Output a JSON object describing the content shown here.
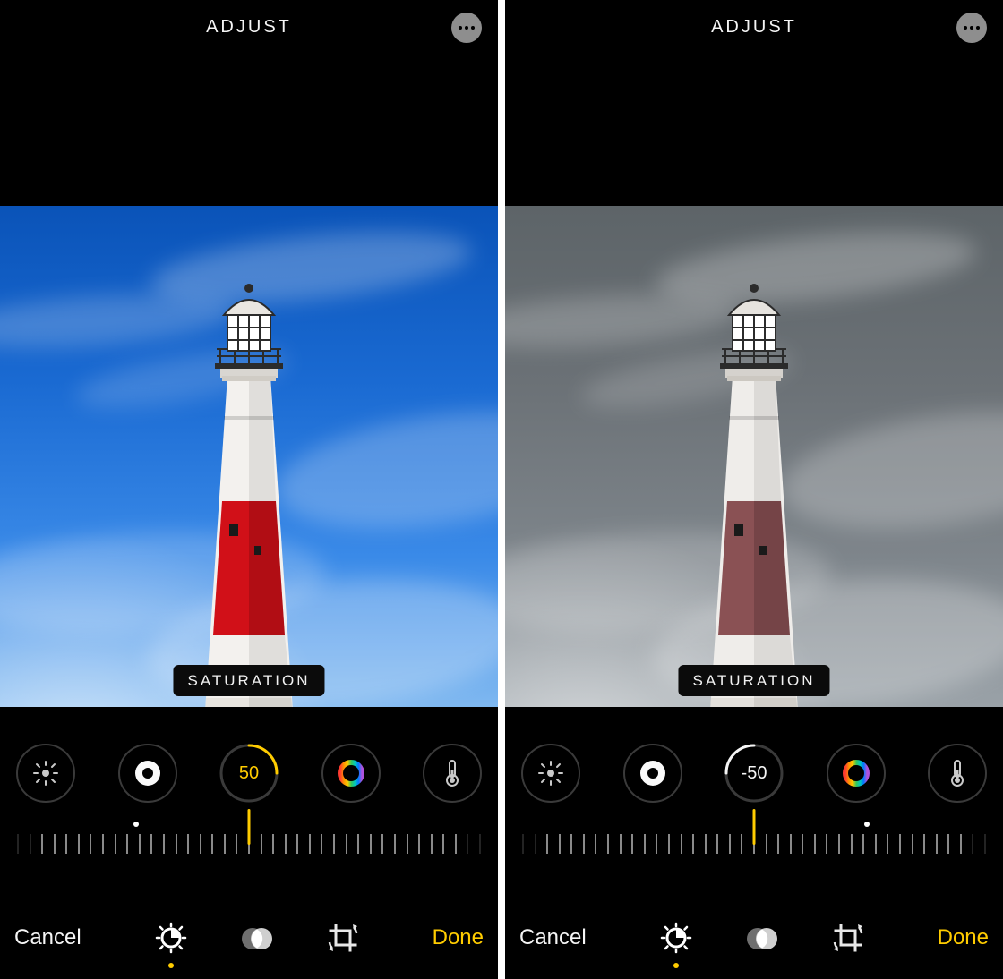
{
  "panels": [
    {
      "title": "ADJUST",
      "adjustment_label": "SATURATION",
      "value": "50",
      "value_color": "yellow",
      "sky_class": "saturated",
      "band_color": "#d11018",
      "origin_left_pct": 25.5,
      "cancel": "Cancel",
      "done": "Done"
    },
    {
      "title": "ADJUST",
      "adjustment_label": "SATURATION",
      "value": "-50",
      "value_color": "white",
      "sky_class": "desaturated",
      "band_color": "#8a5154",
      "origin_left_pct": 74.5,
      "cancel": "Cancel",
      "done": "Done"
    }
  ],
  "dial_icons": [
    "brightness",
    "exposure",
    "value",
    "vibrance",
    "warmth"
  ],
  "bottom_tools": [
    "adjust",
    "filters",
    "crop"
  ],
  "active_bottom_tool": 0,
  "colors": {
    "accent": "#ffcc00"
  }
}
